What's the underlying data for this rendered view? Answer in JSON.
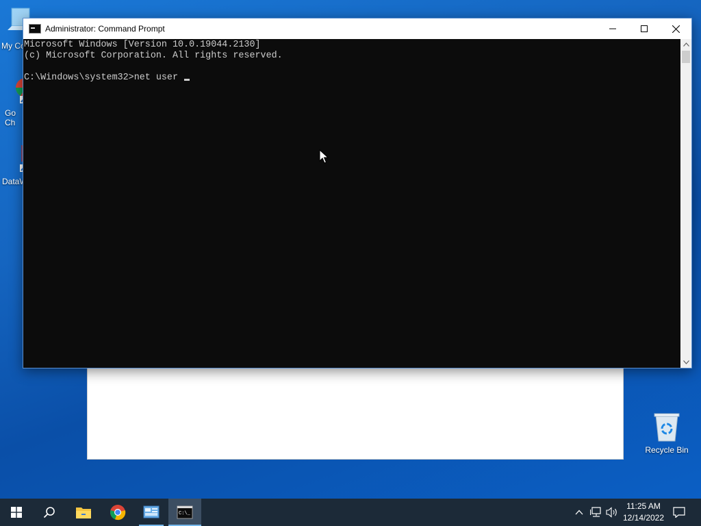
{
  "desktop": {
    "icons": [
      {
        "label": "My Co"
      },
      {
        "label": "Go\nCh"
      },
      {
        "label": "DataW"
      },
      {
        "label": "Recycle Bin"
      }
    ]
  },
  "cmd": {
    "title": "Administrator: Command Prompt",
    "lines": [
      "Microsoft Windows [Version 10.0.19044.2130]",
      "(c) Microsoft Corporation. All rights reserved.",
      "",
      "C:\\Windows\\system32>net user "
    ],
    "text_color": "#cccccc",
    "bg_color": "#0c0c0c"
  },
  "taskbar": {
    "buttons": [
      {
        "name": "start"
      },
      {
        "name": "search"
      },
      {
        "name": "file-explorer"
      },
      {
        "name": "chrome"
      },
      {
        "name": "control-panel"
      },
      {
        "name": "command-prompt",
        "active": true
      }
    ],
    "clock": {
      "time": "11:25 AM",
      "date": "12/14/2022"
    }
  }
}
